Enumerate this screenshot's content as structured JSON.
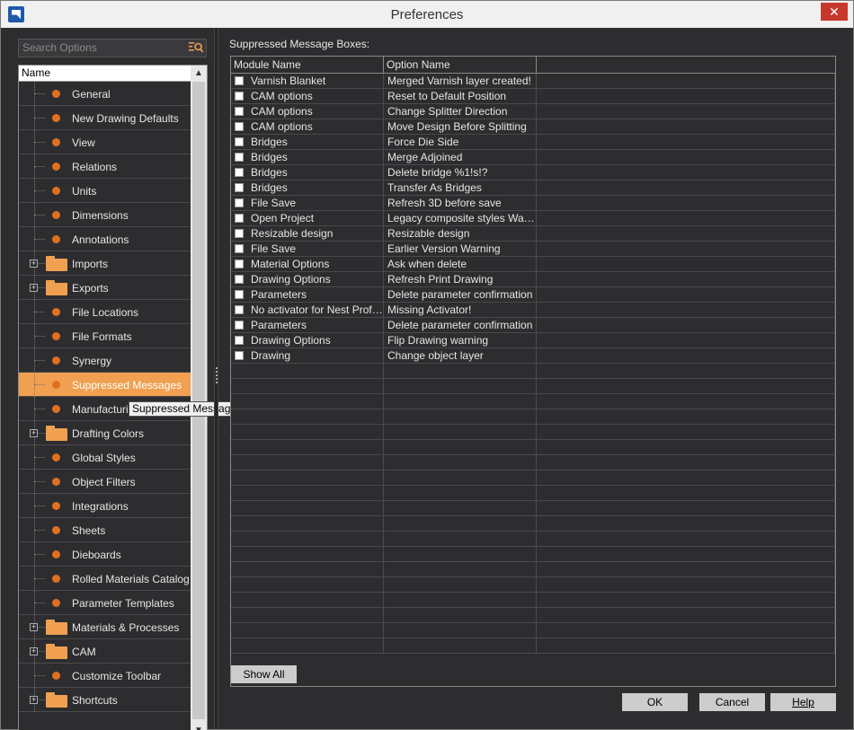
{
  "window": {
    "title": "Preferences",
    "close_glyph": "✕"
  },
  "search": {
    "placeholder": "Search Options"
  },
  "tree": {
    "header": "Name",
    "items": [
      {
        "label": "General",
        "type": "leaf"
      },
      {
        "label": "New Drawing Defaults",
        "type": "leaf"
      },
      {
        "label": "View",
        "type": "leaf"
      },
      {
        "label": "Relations",
        "type": "leaf"
      },
      {
        "label": "Units",
        "type": "leaf"
      },
      {
        "label": "Dimensions",
        "type": "leaf"
      },
      {
        "label": "Annotations",
        "type": "leaf"
      },
      {
        "label": "Imports",
        "type": "folder"
      },
      {
        "label": "Exports",
        "type": "folder"
      },
      {
        "label": "File Locations",
        "type": "leaf"
      },
      {
        "label": "File Formats",
        "type": "leaf"
      },
      {
        "label": "Synergy",
        "type": "leaf"
      },
      {
        "label": "Suppressed Messages",
        "type": "leaf",
        "selected": true
      },
      {
        "label": "Manufacturing",
        "type": "leaf"
      },
      {
        "label": "Drafting Colors",
        "type": "folder"
      },
      {
        "label": "Global Styles",
        "type": "leaf"
      },
      {
        "label": "Object Filters",
        "type": "leaf"
      },
      {
        "label": "Integrations",
        "type": "leaf"
      },
      {
        "label": "Sheets",
        "type": "leaf"
      },
      {
        "label": "Dieboards",
        "type": "leaf"
      },
      {
        "label": "Rolled Materials Catalog",
        "type": "leaf"
      },
      {
        "label": "Parameter Templates",
        "type": "leaf"
      },
      {
        "label": "Materials & Processes",
        "type": "folder"
      },
      {
        "label": "CAM",
        "type": "folder"
      },
      {
        "label": "Customize Toolbar",
        "type": "leaf"
      },
      {
        "label": "Shortcuts",
        "type": "folder"
      }
    ],
    "tooltip": "Suppressed Messages"
  },
  "main": {
    "section_label": "Suppressed Message Boxes:",
    "columns": [
      "Module Name",
      "Option Name",
      ""
    ],
    "rows": [
      {
        "module": "Varnish Blanket",
        "option": "Merged Varnish layer created!"
      },
      {
        "module": "CAM options",
        "option": "Reset to Default Position"
      },
      {
        "module": "CAM options",
        "option": "Change Splitter Direction"
      },
      {
        "module": "CAM options",
        "option": "Move Design Before Splitting"
      },
      {
        "module": "Bridges",
        "option": "Force Die Side"
      },
      {
        "module": "Bridges",
        "option": "Merge Adjoined"
      },
      {
        "module": "Bridges",
        "option": "Delete bridge %1!s!?"
      },
      {
        "module": "Bridges",
        "option": "Transfer As Bridges"
      },
      {
        "module": "File Save",
        "option": "Refresh 3D before save"
      },
      {
        "module": "Open Project",
        "option": "Legacy composite styles Warning"
      },
      {
        "module": "Resizable design",
        "option": "Resizable design"
      },
      {
        "module": "File Save",
        "option": "Earlier Version Warning"
      },
      {
        "module": "Material Options",
        "option": "Ask when delete"
      },
      {
        "module": "Drawing Options",
        "option": "Refresh Print Drawing"
      },
      {
        "module": "Parameters",
        "option": "Delete parameter confirmation"
      },
      {
        "module": "No activator for Nest Profess...",
        "option": "Missing Activator!"
      },
      {
        "module": "Parameters",
        "option": "Delete parameter confirmation"
      },
      {
        "module": "Drawing Options",
        "option": "Flip Drawing warning"
      },
      {
        "module": "Drawing",
        "option": "Change object layer"
      }
    ],
    "empty_rows": 19
  },
  "buttons": {
    "show_all": "Show All",
    "ok": "OK",
    "cancel": "Cancel",
    "help": "Help"
  }
}
